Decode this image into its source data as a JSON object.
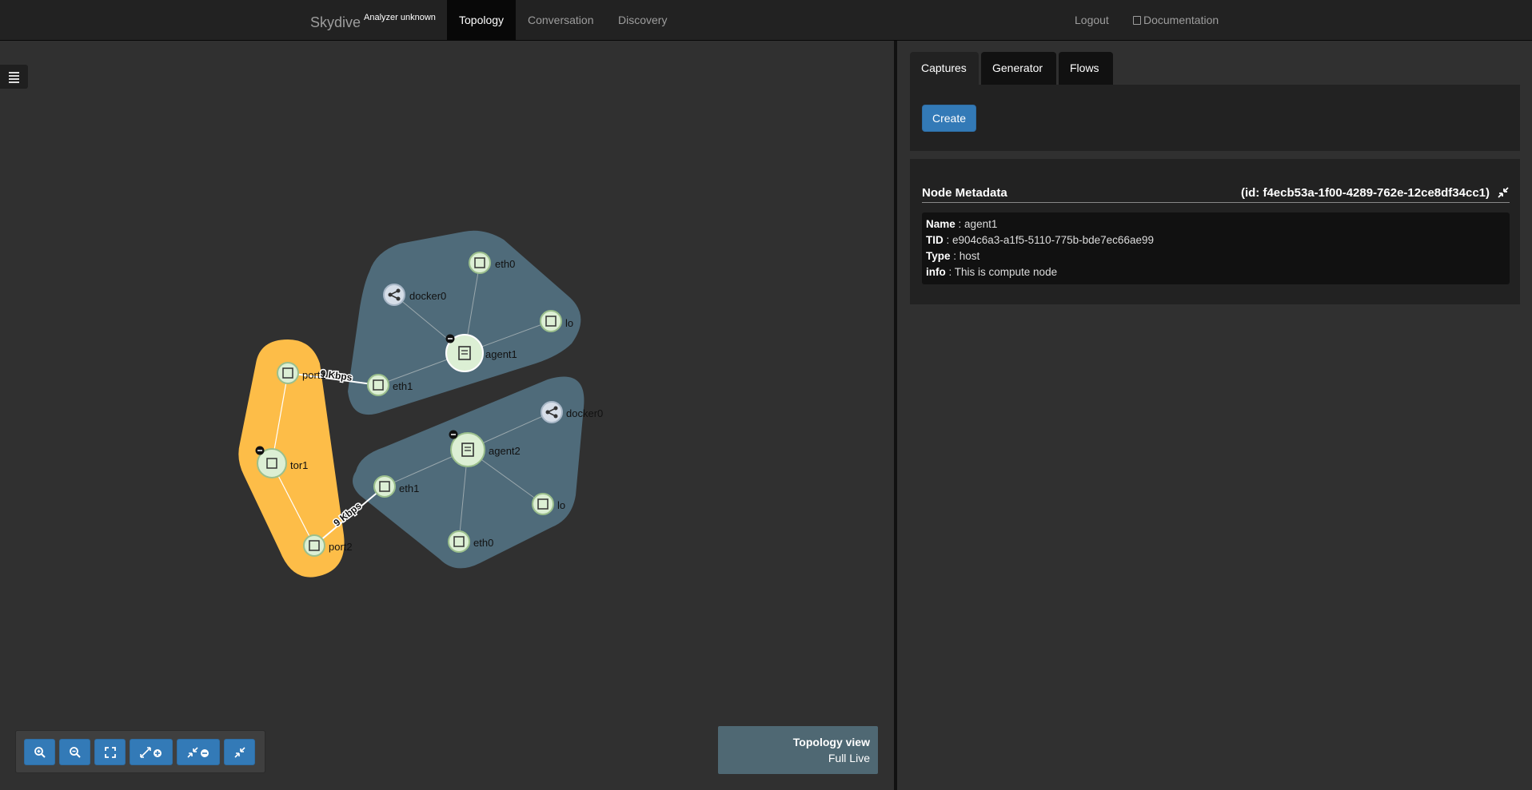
{
  "nav": {
    "brand": "Skydive",
    "brand_sub": "Analyzer unknown",
    "tabs": [
      "Topology",
      "Conversation",
      "Discovery"
    ],
    "logout": "Logout",
    "documentation": "Documentation"
  },
  "graph": {
    "nodes": {
      "agent1": "agent1",
      "agent1_eth0": "eth0",
      "agent1_docker0": "docker0",
      "agent1_lo": "lo",
      "agent1_eth1": "eth1",
      "agent2": "agent2",
      "agent2_docker0": "docker0",
      "agent2_eth1": "eth1",
      "agent2_lo": "lo",
      "agent2_eth0": "eth0",
      "tor1": "tor1",
      "port1": "port1",
      "port2": "port2"
    },
    "link_labels": [
      "9 Kbps",
      "9 Kbps"
    ],
    "colors": {
      "host_group": "#4f6b7a",
      "tor_group": "#fdbd48",
      "node_fill": "#dcefd4",
      "bridge_fill": "#d6dee8"
    }
  },
  "toolbar": {
    "icons": [
      "zoom-in-icon",
      "zoom-out-icon",
      "fullscreen-icon",
      "expand-all-icon",
      "collapse-all-icon",
      "collapse-icon"
    ]
  },
  "view": {
    "title": "Topology view",
    "mode": "Full Live"
  },
  "right": {
    "tabs": [
      "Captures",
      "Generator",
      "Flows"
    ],
    "create_label": "Create",
    "metadata": {
      "title": "Node Metadata",
      "id": "(id: f4ecb53a-1f00-4289-762e-12ce8df34cc1)",
      "fields": [
        {
          "key": "Name",
          "value": "agent1"
        },
        {
          "key": "TID",
          "value": "e904c6a3-a1f5-5110-775b-bde7ec66ae99"
        },
        {
          "key": "Type",
          "value": "host"
        },
        {
          "key": "info",
          "value": "This is compute node"
        }
      ]
    }
  }
}
